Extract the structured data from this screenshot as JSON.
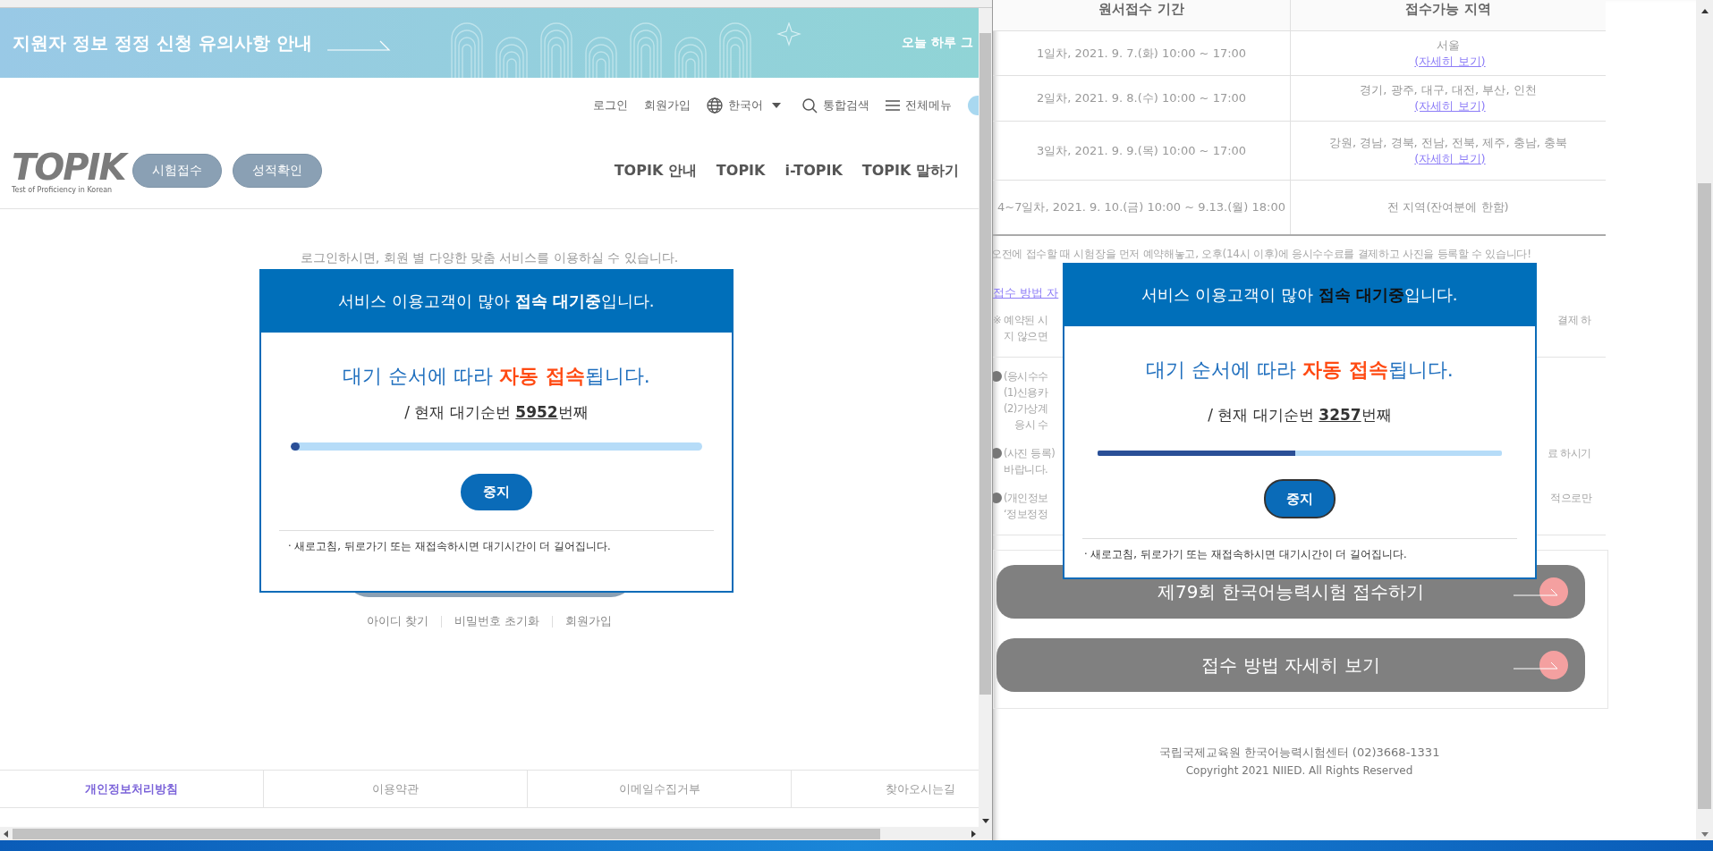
{
  "left_window": {
    "banner": {
      "title": "지원자 정보 정정 신청 유의사항 안내",
      "close_text": "오늘 하루 그"
    },
    "utility_nav": {
      "login": "로그인",
      "signup": "회원가입",
      "language": "한국어",
      "search": "통합검색",
      "menu": "전체메뉴"
    },
    "logo": {
      "text": "TOPIK",
      "subtitle": "Test of Proficiency in Korean"
    },
    "quick_buttons": [
      "시험접수",
      "성적확인"
    ],
    "main_nav": [
      "TOPIK 안내",
      "TOPIK",
      "i-TOPIK",
      "TOPIK 말하기"
    ],
    "intro_text": "로그인하시면, 회원 별 다양한 맞춤 서비스를 이용하실 수 있습니다.",
    "account_links": [
      "아이디 찾기",
      "비밀번호 초기화",
      "회원가입"
    ],
    "footer_links": [
      {
        "label": "개인정보처리방침",
        "selected": true
      },
      {
        "label": "이용약관",
        "selected": false
      },
      {
        "label": "이메일수집거부",
        "selected": false
      },
      {
        "label": "찾아오시는길",
        "selected": false
      }
    ],
    "queue_modal": {
      "header": "서비스 이용고객이 많아 **접속 대기중**입니다.",
      "message": "대기 순서에 따라 **자동 접속**됩니다.",
      "position": "/ 현재 대기순번 **5952**번째",
      "level": 0.02,
      "stop_button": {
        "label": "중지",
        "focused": false
      },
      "note": "· 새로고침, 뒤로가기 또는 재접속하시면 대기시간이 더 길어집니다."
    }
  },
  "right_window": {
    "table": {
      "columns": [
        "원서접수 기간",
        "접수가능 지역"
      ],
      "rows": [
        {
          "period": "1일차, 2021. 9. 7.(화) 10:00 ~ 17:00",
          "region": "서울",
          "link": "(자세히 보기)"
        },
        {
          "period": "2일차, 2021. 9. 8.(수) 10:00 ~ 17:00",
          "region": "경기, 광주, 대구, 대전, 부산, 인천",
          "link": "(자세히 보기)"
        },
        {
          "period": "3일차, 2021. 9. 9.(목) 10:00 ~ 17:00",
          "region": "강원, 경남, 경북, 전남, 전북, 제주, 충남, 충북",
          "link": "(자세히 보기)"
        },
        {
          "period": "4~7일차, 2021. 9. 10.(금) 10:00 ~ 9.13.(월) 18:00",
          "region": "전 지역(잔여분에 한함)"
        }
      ]
    },
    "notice": "오전에 접수할 때 시험장을 먼저 예약해놓고, 오후(14시 이후)에 응시수수료를 결제하고 사진을 등록할 수 있습니다!",
    "guide_link": "접수 방법 자",
    "note_sections": [
      {
        "items": [
          {
            "bullet": false,
            "lines": [
              {
                "left": "※ 예약된 시",
                "right": "결제 하",
                "sub": false
              },
              {
                "left": "지 않으면",
                "sub": false
              }
            ]
          }
        ]
      },
      {
        "items": [
          {
            "bullet": true,
            "lines": [
              {
                "left": "(응시수수",
                "sub": false
              },
              {
                "left": "(1)신용카",
                "sub": false
              },
              {
                "left": "(2)가상계",
                "sub": false
              },
              {
                "left": "응시 수",
                "sub": true
              }
            ]
          },
          {
            "bullet": true,
            "lines": [
              {
                "left": "(사진 등록)",
                "right": "료 하시기",
                "sub": false
              },
              {
                "left": "바랍니다.",
                "sub": false
              }
            ]
          },
          {
            "bullet": true,
            "lines": [
              {
                "left": "(개인정보",
                "right": "적으로만",
                "sub": false
              },
              {
                "left": "‘정보정정",
                "sub": false
              }
            ]
          }
        ]
      }
    ],
    "action_buttons": [
      "제79회 한국어능력시험 접수하기",
      "접수 방법 자세히 보기"
    ],
    "footer": {
      "address": "국립국제교육원 한국어능력시험센터 (02)3668-1331",
      "copyright": "Copyright 2021 NIIED. All Rights Reserved"
    },
    "queue_modal": {
      "header": "서비스 이용고객이 많아 **접속 대기중**입니다.",
      "message": "대기 순서에 따라 **자동 접속**됩니다.",
      "position": "/ 현재 대기순번 **3257**번째",
      "level": 0.49,
      "stop_button": {
        "label": "중지",
        "focused": true
      },
      "note": "· 새로고침, 뒤로가기 또는 재접속하시면 대기시간이 더 길어집니다."
    }
  }
}
